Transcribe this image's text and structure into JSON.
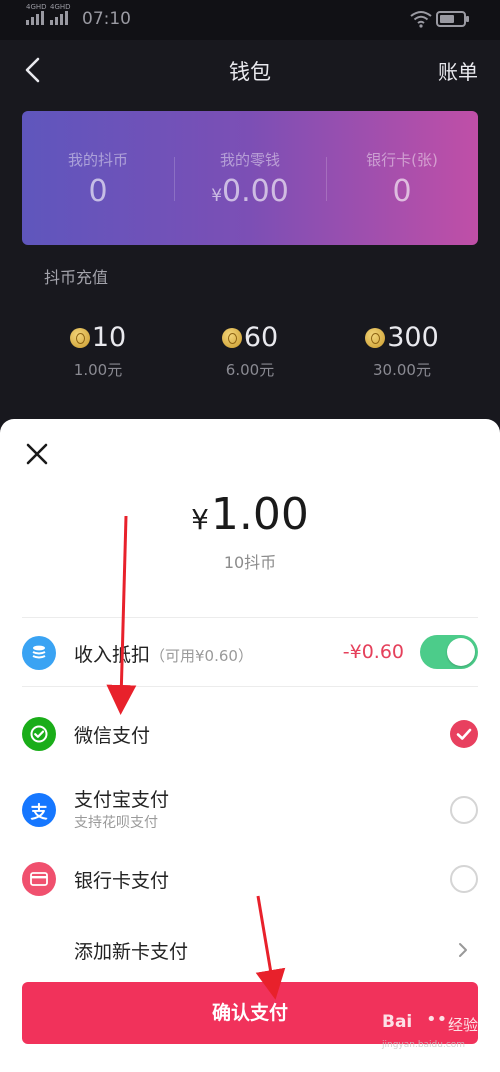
{
  "status_bar": {
    "network_1": "4GHD",
    "network_2": "4GHD",
    "time": "07:10"
  },
  "nav": {
    "title": "钱包",
    "bill": "账单"
  },
  "balance": [
    {
      "label": "我的抖币",
      "value": "0"
    },
    {
      "label": "我的零钱",
      "currency": "¥",
      "value": "0.00"
    },
    {
      "label": "银行卡(张)",
      "value": "0"
    }
  ],
  "recharge": {
    "title": "抖币充值",
    "options": [
      {
        "amount": "10",
        "price": "1.00元"
      },
      {
        "amount": "60",
        "price": "6.00元"
      },
      {
        "amount": "300",
        "price": "30.00元"
      }
    ]
  },
  "sheet": {
    "currency": "¥",
    "amount": "1.00",
    "amount_sub": "10抖币",
    "deduction": {
      "label": "收入抵扣",
      "hint": "（可用¥0.60）",
      "value": "-¥0.60",
      "enabled": true
    },
    "methods": [
      {
        "label": "微信支付",
        "icon": "wechat-pay-icon",
        "selected": true
      },
      {
        "label": "支付宝支付",
        "sub": "支持花呗支付",
        "icon": "alipay-icon",
        "icon_glyph": "支",
        "selected": false
      },
      {
        "label": "银行卡支付",
        "icon": "bank-card-icon",
        "selected": false
      }
    ],
    "add_card": "添加新卡支付",
    "confirm": "确认支付"
  },
  "watermark": {
    "brand": "Bai",
    "brand_suffix": "经验",
    "url": "jingyan.baidu.com"
  },
  "colors": {
    "accent": "#f1325b",
    "toggle_on": "#4ccc8a",
    "wechat": "#1aad19",
    "alipay": "#1677ff",
    "bank": "#f0506e",
    "deduct_icon": "#3aa3f3",
    "annotation_arrow": "#e8212b"
  }
}
